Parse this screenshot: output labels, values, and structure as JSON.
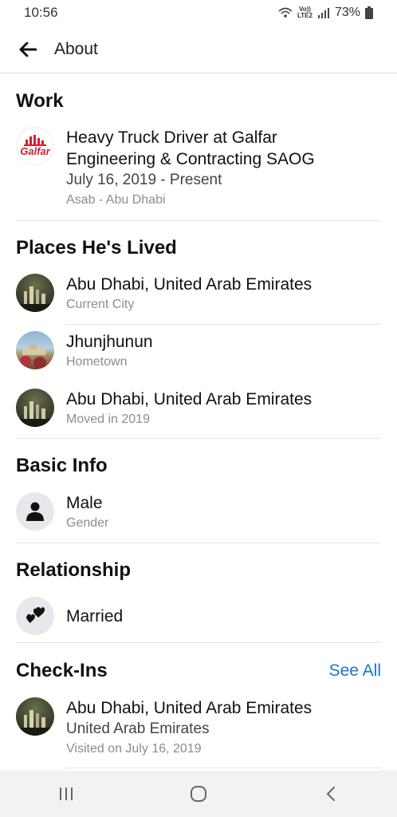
{
  "status_bar": {
    "time": "10:56",
    "network_top": "Vo))",
    "network_bottom": "LTE2",
    "battery": "73%"
  },
  "header": {
    "title": "About"
  },
  "work": {
    "title": "Work",
    "company_logo_text": "Galfar",
    "job": "Heavy Truck Driver at Galfar Engineering & Contracting SAOG",
    "dates": "July 16, 2019 - Present",
    "location": "Asab - Abu Dhabi"
  },
  "places": {
    "title": "Places He's Lived",
    "items": [
      {
        "name": "Abu Dhabi, United Arab Emirates",
        "detail": "Current City"
      },
      {
        "name": "Jhunjhunun",
        "detail": "Hometown"
      },
      {
        "name": "Abu Dhabi, United Arab Emirates",
        "detail": "Moved in 2019"
      }
    ]
  },
  "basic_info": {
    "title": "Basic Info",
    "value": "Male",
    "label": "Gender"
  },
  "relationship": {
    "title": "Relationship",
    "value": "Married"
  },
  "checkins": {
    "title": "Check-Ins",
    "see_all": "See All",
    "item": {
      "name": "Abu Dhabi, United Arab Emirates",
      "country": "United Arab Emirates",
      "visited": "Visited on July 16, 2019"
    }
  },
  "colors": {
    "link": "#1877c9",
    "logo_red": "#d0202e"
  }
}
